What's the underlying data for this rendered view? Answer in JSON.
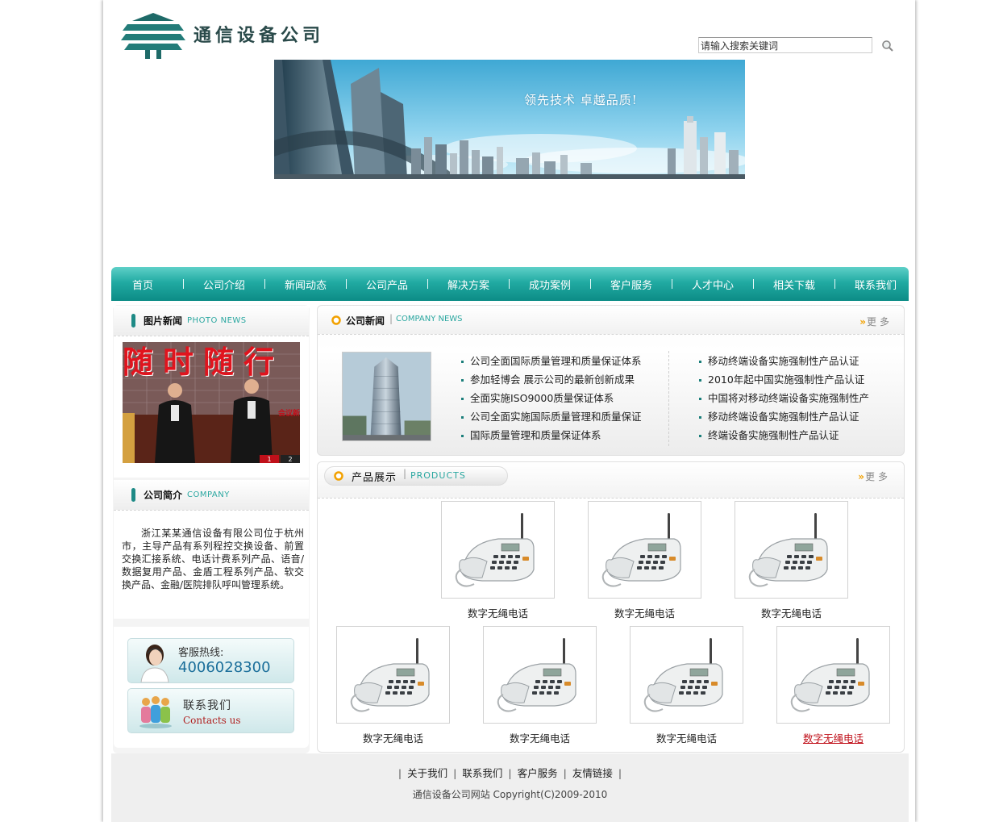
{
  "header": {
    "company_name": "通信设备公司",
    "search_value": "请输入搜索关键词",
    "banner_slogan": "领先技术  卓越品质!"
  },
  "nav": {
    "items": [
      "首页",
      "公司介绍",
      "新闻动态",
      "公司产品",
      "解决方案",
      "成功案例",
      "客户服务",
      "人才中心",
      "相关下载",
      "联系我们"
    ]
  },
  "photo_news": {
    "title": "图片新闻",
    "subtitle": "PHOTO NEWS",
    "photo_banner": "随时随行",
    "photo_caption": "会议新",
    "pages": [
      "1",
      "2"
    ]
  },
  "company_intro": {
    "title": "公司简介",
    "subtitle": "COMPANY",
    "text": "浙江某某通信设备有限公司位于杭州市，主导产品有系列程控交换设备、前置交换汇接系统、电话计费系列产品、语音/数据复用产品、金盾工程系列产品、软交换产品、金融/医院排队呼叫管理系统。"
  },
  "hotline": {
    "label": "客服热线:",
    "number": "4006028300"
  },
  "contact": {
    "label_cn": "联系我们",
    "label_en": "Contacts us"
  },
  "company_news": {
    "title": "公司新闻",
    "subtitle": "COMPANY NEWS",
    "more": "更多",
    "left_items": [
      "公司全面国际质量管理和质量保证体系",
      "参加轻博会 展示公司的最新创新成果",
      "全面实施ISO9000质量保证体系",
      "公司全面实施国际质量管理和质量保证",
      "国际质量管理和质量保证体系"
    ],
    "right_items": [
      "移动终端设备实施强制性产品认证",
      "2010年起中国实施强制性产品认证",
      "中国将对移动终端设备实施强制性产",
      "移动终端设备实施强制性产品认证",
      "终端设备实施强制性产品认证"
    ]
  },
  "products": {
    "title": "产品展示",
    "subtitle": "PRODUCTS",
    "more": "更多",
    "items": [
      "数字无绳电话",
      "数字无绳电话",
      "数字无绳电话",
      "数字无绳电话",
      "数字无绳电话",
      "数字无绳电话",
      "数字无绳电话"
    ]
  },
  "footer": {
    "links": [
      "关于我们",
      "联系我们",
      "客户服务",
      "友情链接"
    ],
    "copyright": "通信设备公司网站 Copyright(C)2009-2010"
  },
  "colors": {
    "brand": "#1e8a86",
    "nav_top": "#5ed0c8",
    "nav_bottom": "#0c8c86",
    "accent": "#f2a100",
    "link_hover": "#c0101a"
  }
}
